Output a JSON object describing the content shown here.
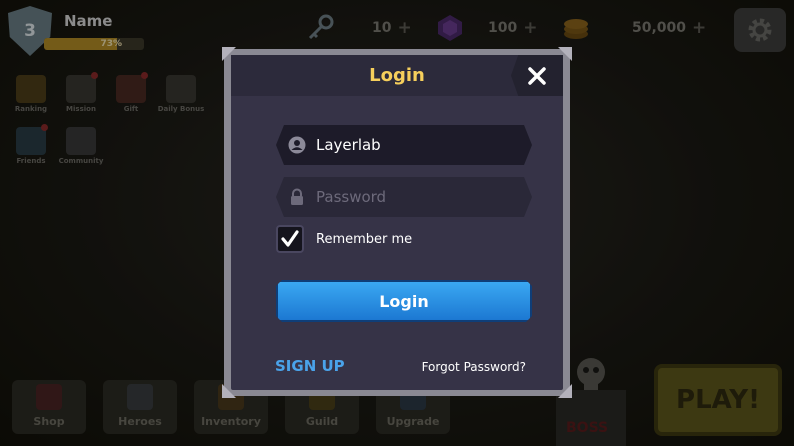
{
  "hud": {
    "level": "3",
    "player_name": "Name",
    "xp_text": "73%",
    "xp_fraction": 0.73,
    "resources": [
      {
        "icon": "key-icon",
        "value": "10"
      },
      {
        "icon": "gem-icon",
        "value": "100"
      },
      {
        "icon": "coin-icon",
        "value": "50,000"
      }
    ],
    "settings_icon": "gear-icon"
  },
  "side_menu": [
    {
      "label": "Ranking",
      "icon": "trophy-icon",
      "alert": false
    },
    {
      "label": "Mission",
      "icon": "mission-icon",
      "alert": true
    },
    {
      "label": "Gift",
      "icon": "gift-icon",
      "alert": true
    },
    {
      "label": "Daily Bonus",
      "icon": "calendar-icon",
      "alert": false
    },
    {
      "label": "Friends",
      "icon": "friends-icon",
      "alert": true
    },
    {
      "label": "Community",
      "icon": "chat-icon",
      "alert": false
    }
  ],
  "bottom_nav": [
    {
      "label": "Shop",
      "icon": "shop-icon"
    },
    {
      "label": "Heroes",
      "icon": "helmet-icon"
    },
    {
      "label": "Inventory",
      "icon": "chest-icon"
    },
    {
      "label": "Guild",
      "icon": "guild-icon"
    },
    {
      "label": "Upgrade",
      "icon": "upgrade-icon"
    }
  ],
  "boss_label": "BOSS",
  "play_label": "PLAY!",
  "login_modal": {
    "title": "Login",
    "username_value": "Layerlab",
    "password_placeholder": "Password",
    "remember_label": "Remember me",
    "remember_checked": true,
    "login_button": "Login",
    "signup_link": "SIGN UP",
    "forgot_link": "Forgot Password?"
  },
  "colors": {
    "title_gold": "#f6cf5c",
    "button_blue": "#2a90e4",
    "link_blue": "#4aa3ea",
    "panel": "#363347"
  }
}
